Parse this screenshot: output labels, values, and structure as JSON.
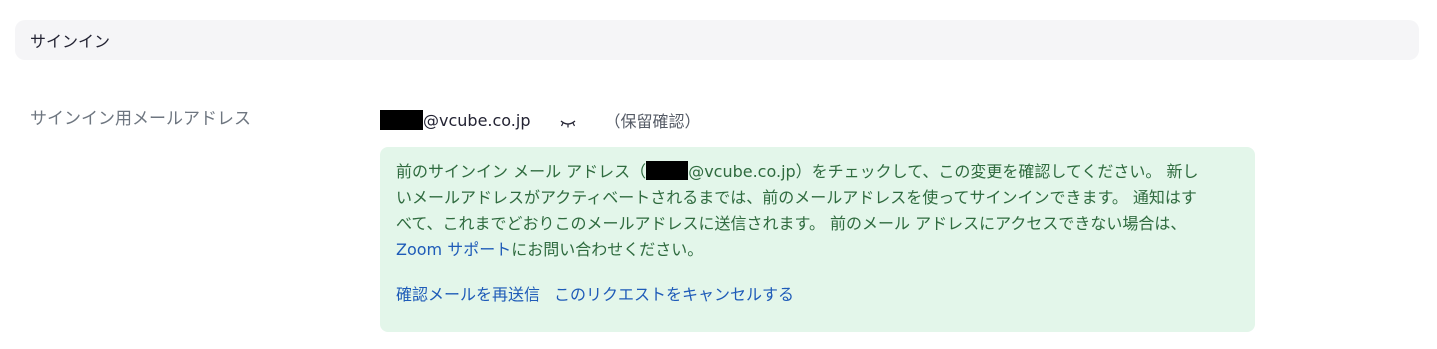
{
  "section": {
    "title": "サインイン"
  },
  "field": {
    "label": "サインイン用メールアドレス"
  },
  "email": {
    "domain": "@vcube.co.jp",
    "status": "（保留確認）",
    "visibility_icon": "eye-closed-icon"
  },
  "notice": {
    "text_before_email": "前のサインイン メール アドレス（",
    "email_domain": "@vcube.co.jp",
    "text_after_email": "）をチェックして、この変更を確認してください。 新しいメールアドレスがアクティベートされるまでは、前のメールアドレスを使ってサインインできます。 通知はすべて、これまでどおりこのメールアドレスに送信されます。 前のメール アドレスにアクセスできない場合は、",
    "support_link": "Zoom サポート",
    "text_end": "にお問い合わせください。",
    "resend_link": "確認メールを再送信",
    "cancel_link": "このリクエストをキャンセルする"
  },
  "colors": {
    "notice_bg": "#e3f6ea",
    "notice_text": "#2f6b3f",
    "link": "#1e5bb8",
    "header_bg": "#f5f5f7"
  }
}
